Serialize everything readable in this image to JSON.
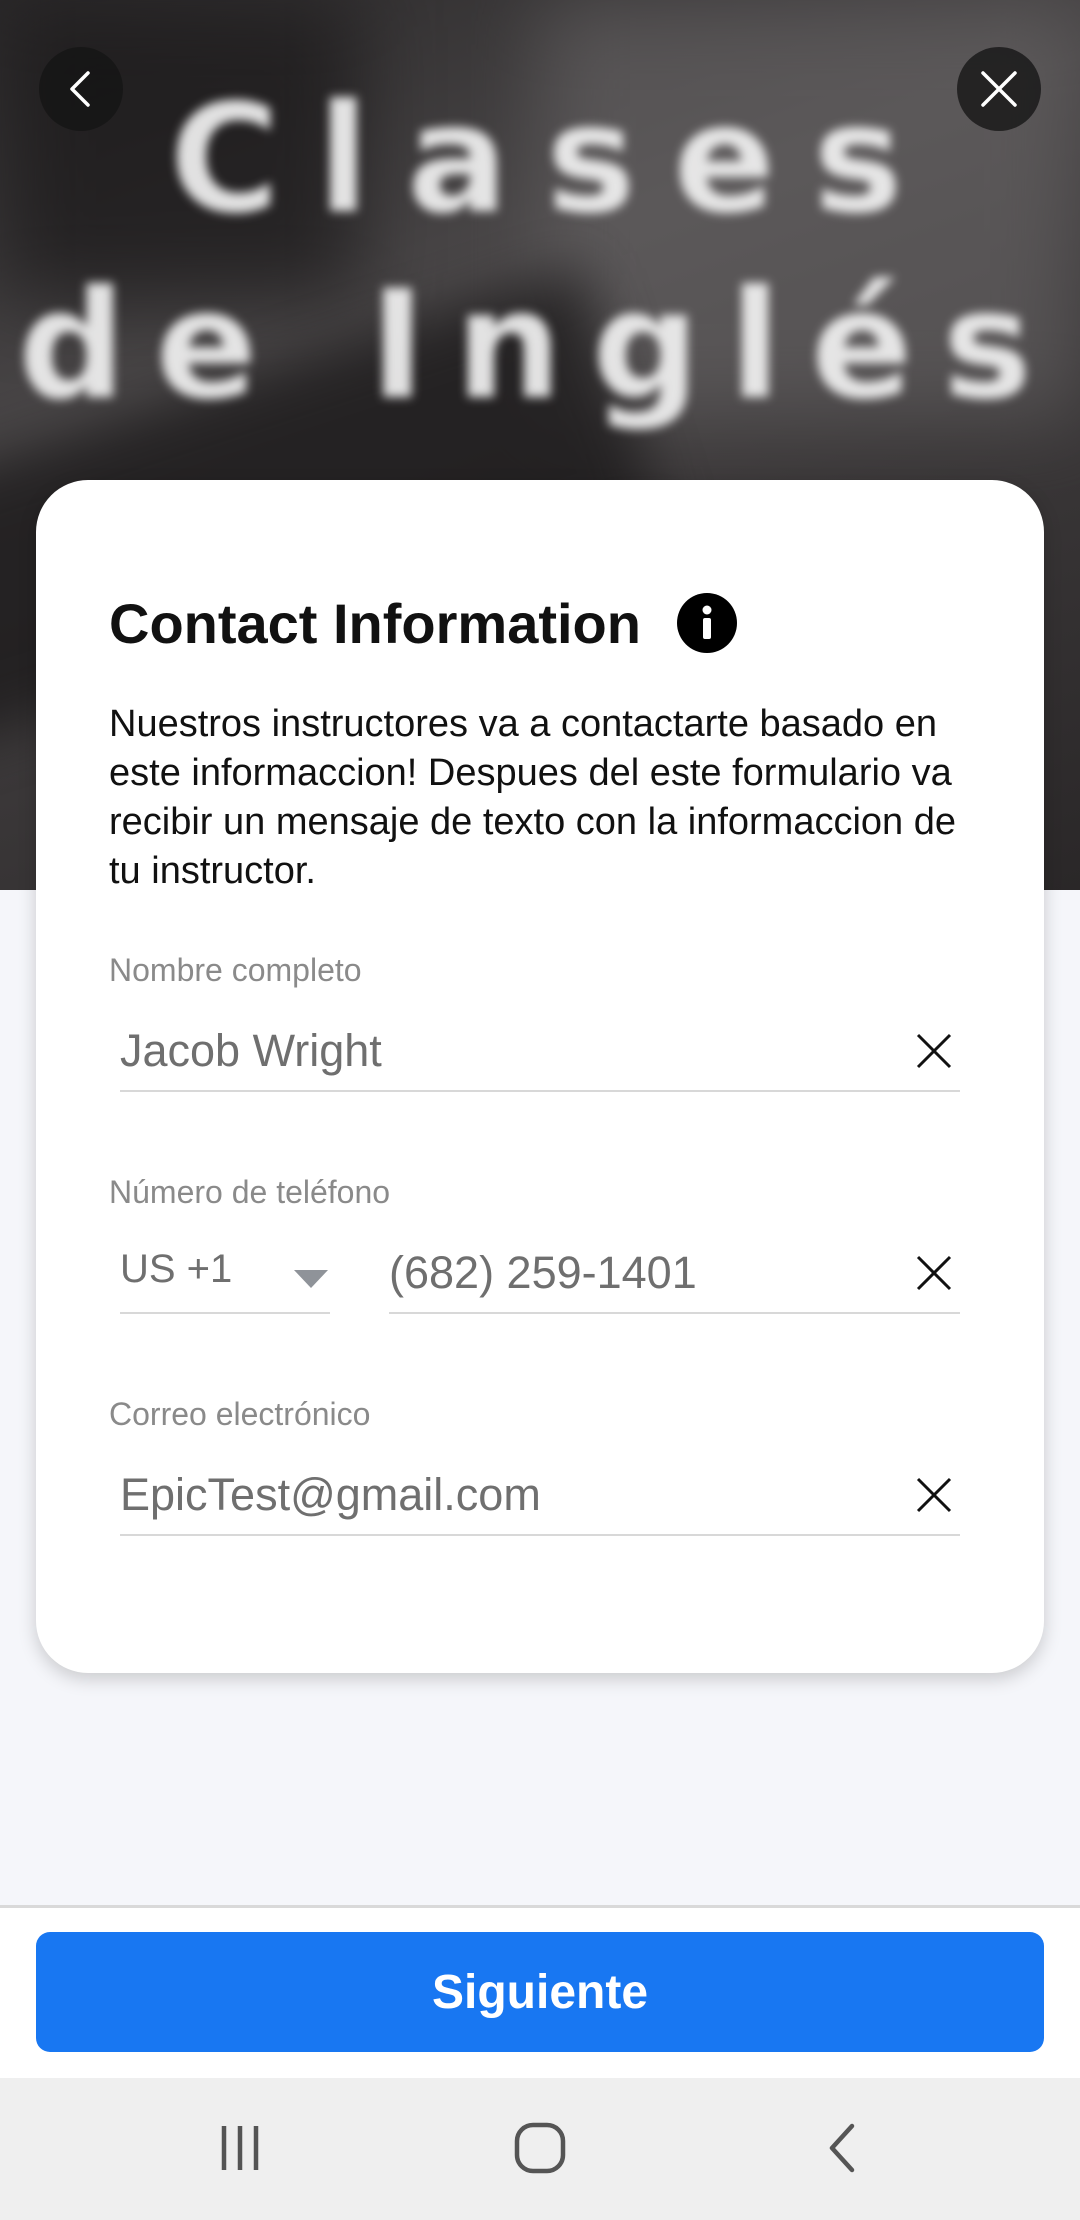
{
  "hero": {
    "line1": "Clases",
    "line2": "de Inglés"
  },
  "icons": {
    "back": "chevron-left-icon",
    "close": "close-icon",
    "info": "info-icon",
    "clear": "clear-x-icon",
    "dropdown": "caret-down-icon",
    "nav_recents": "recent-apps-icon",
    "nav_home": "home-icon",
    "nav_back": "back-icon"
  },
  "card": {
    "title": "Contact Information",
    "description": "Nuestros instructores va a contactarte basado en este informaccion! Despues del este formulario va recibir un mensaje de texto con la informaccion de tu instructor."
  },
  "form": {
    "name": {
      "label": "Nombre completo",
      "value": "Jacob Wright"
    },
    "phone": {
      "label": "Número de teléfono",
      "country_code": "US +1",
      "value": "(682) 259-1401"
    },
    "email": {
      "label": "Correo electrónico",
      "value": "EpicTest@gmail.com"
    }
  },
  "actions": {
    "next_label": "Siguiente"
  },
  "colors": {
    "primary": "#1877f2",
    "background": "#f5f6fa",
    "label": "#8a8a8a",
    "value": "#6f6f6f"
  }
}
